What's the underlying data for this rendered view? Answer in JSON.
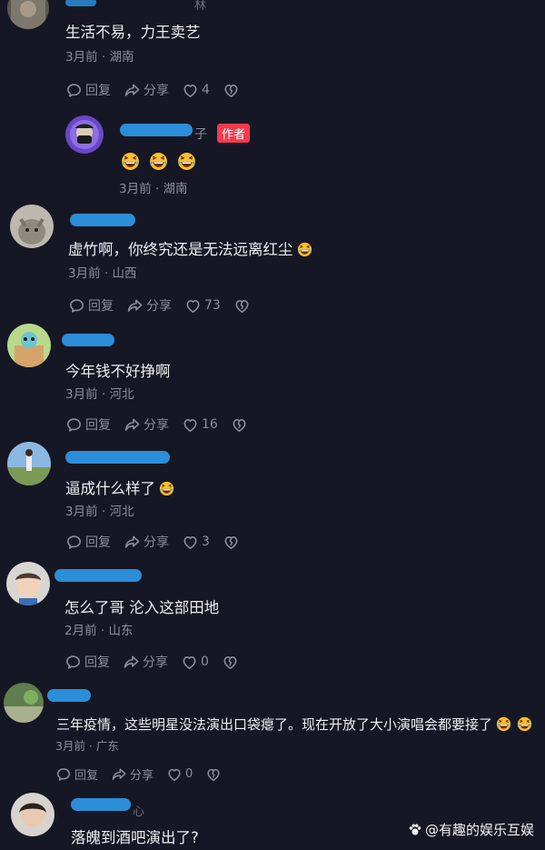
{
  "icons": {
    "reply": "comment-bubble-icon",
    "share": "share-arrow-icon",
    "like": "heart-icon",
    "dislike": "broken-heart-icon",
    "emoji": "laughing-emoji-icon"
  },
  "colors": {
    "background": "#161724",
    "author_badge": "#f23a4f",
    "meta_text": "#8c8d9a",
    "redaction": "#2c8ed9"
  },
  "labels": {
    "reply": "回复",
    "share": "分享"
  },
  "comments": [
    {
      "name_fragment": "林",
      "text": "生活不易，力王卖艺",
      "meta": "3月前 · 湖南",
      "likes": "4"
    },
    {
      "name_fragment": "子",
      "author_badge": "作者",
      "text": "",
      "meta": "3月前 · 湖南"
    },
    {
      "text": "虚竹啊，你终究还是无法远离红尘",
      "meta": "3月前 · 山西",
      "likes": "73"
    },
    {
      "text": "今年钱不好挣啊",
      "meta": "3月前 · 河北",
      "likes": "16"
    },
    {
      "text": "逼成什么样了",
      "meta": "3月前 · 河北",
      "likes": "3"
    },
    {
      "text": "怎么了哥 沦入这部田地",
      "meta": "2月前 · 山东",
      "likes": "0"
    },
    {
      "text": "三年疫情，这些明星没法演出口袋瘪了。现在开放了大小演唱会都要接了",
      "meta": "3月前 · 广东",
      "likes": "0"
    },
    {
      "name_fragment": "心",
      "text": "落魄到酒吧演出了?"
    }
  ],
  "watermark": {
    "text": "@有趣的娱乐互娱"
  }
}
